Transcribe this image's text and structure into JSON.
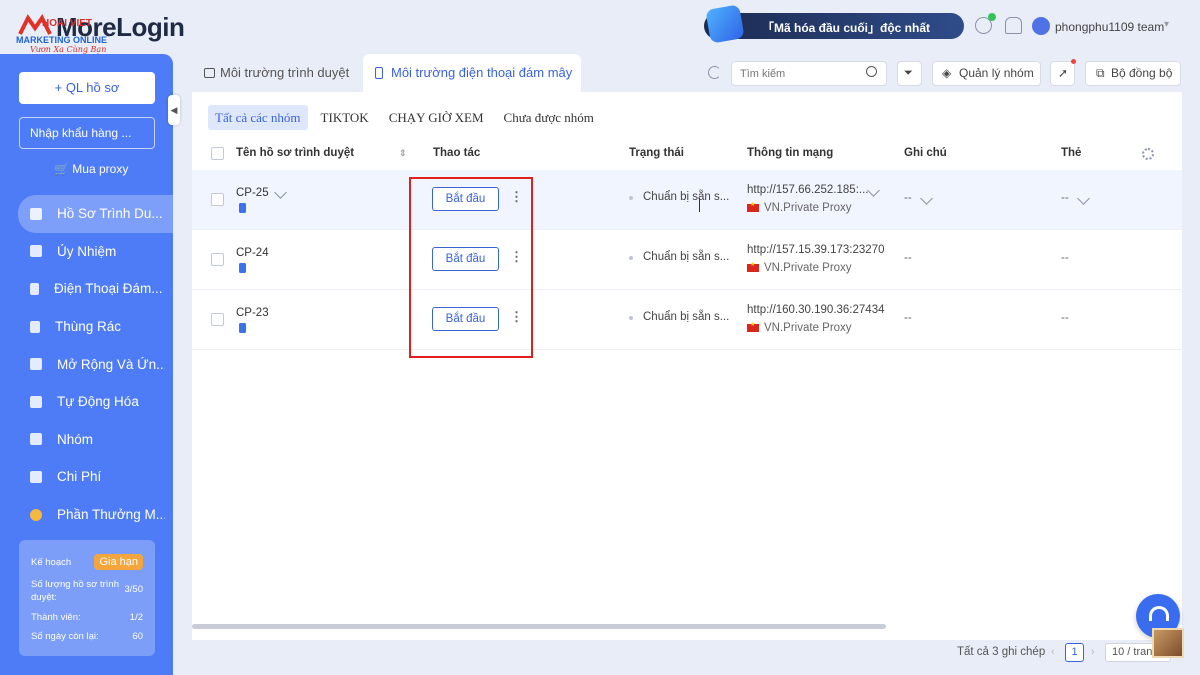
{
  "app": {
    "logo_text": "MoreLogin",
    "watermark_line1": "MARKETING ONLINE",
    "watermark_line2": "Vươn Xa Cùng Bạn",
    "watermark_overlay": "HOAI VIET"
  },
  "topbar": {
    "promo_text": "「Mã hóa đầu cuối」độc nhất",
    "team_name": "phongphu1109 team"
  },
  "sidebar": {
    "profile_button": "+ QL hồ sơ",
    "import_button": "Nhập khẩu hàng ...",
    "buy_proxy": "Mua proxy",
    "items": [
      {
        "label": "Hồ Sơ Trình Du...",
        "active": true
      },
      {
        "label": "Ủy Nhiệm"
      },
      {
        "label": "Điện Thoại Đám..."
      },
      {
        "label": "Thùng Rác"
      },
      {
        "label": "Mở Rộng Và Ứn..."
      },
      {
        "label": "Tự Động Hóa"
      },
      {
        "label": "Nhóm"
      },
      {
        "label": "Chi Phí"
      },
      {
        "label": "Phần Thưởng M..."
      }
    ],
    "plan": {
      "title": "Kế hoạch",
      "renew": "Gia hạn",
      "profiles_label": "Số lượng hồ sơ trình duyệt:",
      "profiles_value": "3/50",
      "members_label": "Thành viên:",
      "members_value": "1/2",
      "days_label": "Số ngày còn lại:",
      "days_value": "60"
    }
  },
  "tabs": [
    {
      "label": "Môi trường trình duyệt"
    },
    {
      "label": "Môi trường điện thoại đám mây",
      "active": true
    }
  ],
  "toolbar": {
    "search_placeholder": "Tìm kiếm",
    "group_manage": "Quản lý nhóm",
    "sync": "Bộ đồng bộ"
  },
  "groups": [
    "Tất cả các nhóm",
    "TIKTOK",
    "CHẠY GIỜ XEM",
    "Chưa được nhóm"
  ],
  "table": {
    "headers": {
      "name": "Tên hồ sơ trình duyệt",
      "action": "Thao tác",
      "status": "Trạng thái",
      "network": "Thông tin mạng",
      "note": "Ghi chú",
      "tag": "Thẻ"
    },
    "rows": [
      {
        "name": "CP-25",
        "action": "Bắt đầu",
        "status": "Chuẩn bị sẵn s...",
        "ip": "http://157.66.252.185:...",
        "proxy": "VN.Private Proxy",
        "note": "--",
        "tag": "--"
      },
      {
        "name": "CP-24",
        "action": "Bắt đầu",
        "status": "Chuẩn bị sẵn s...",
        "ip": "http://157.15.39.173:23270",
        "proxy": "VN.Private Proxy",
        "note": "--",
        "tag": "--"
      },
      {
        "name": "CP-23",
        "action": "Bắt đầu",
        "status": "Chuẩn bị sẵn s...",
        "ip": "http://160.30.190.36:27434",
        "proxy": "VN.Private Proxy",
        "note": "--",
        "tag": "--"
      }
    ]
  },
  "footer": {
    "total": "Tất cả 3 ghi chép",
    "page": "1",
    "page_size": "10 / trang"
  },
  "colors": {
    "accent": "#3a63d8",
    "sidebar": "#4e7cf6",
    "highlight": "#e02020"
  }
}
